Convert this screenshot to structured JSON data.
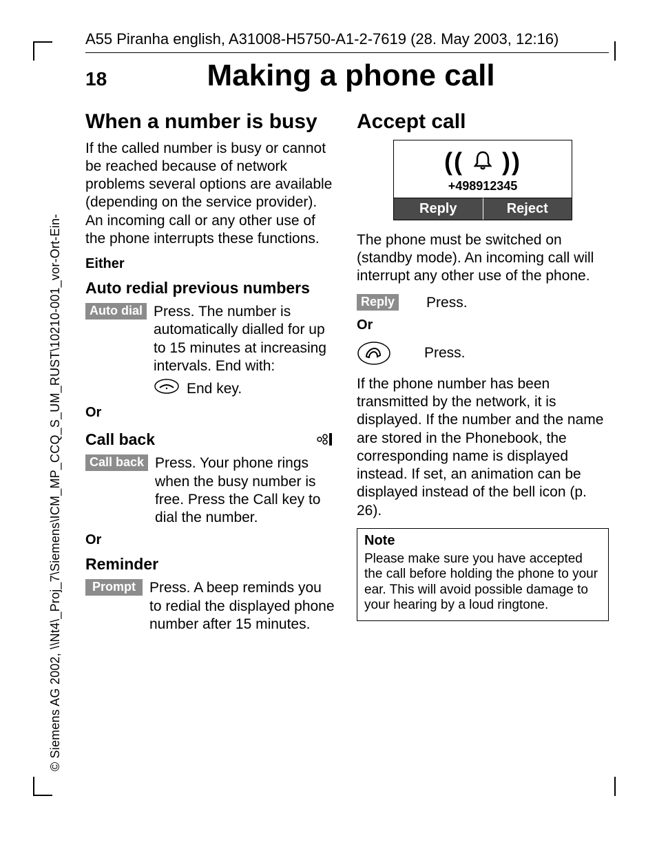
{
  "header": "A55 Piranha english, A31008-H5750-A1-2-7619 (28. May 2003, 12:16)",
  "page_number": "18",
  "page_title": "Making a phone call",
  "side_text": "© Siemens AG 2002, \\\\Nt4\\_Proj_7\\Siemens\\ICM_MP_CCQ_S_UM_RUST\\10210-001_vor-Ort-Ein-",
  "left": {
    "h1": "When a number is busy",
    "intro": "If the called number is busy or cannot be reached because of network problems several options are available (depending on the service provider). An incoming call or any other use of the phone interrupts these functions.",
    "either": "Either",
    "auto_redial_h": "Auto redial previous numbers",
    "auto_dial_key": "Auto dial",
    "auto_dial_text": "Press. The number is automatically dialled for up to 15 minutes at increasing intervals. End with:",
    "end_key_label": "End key.",
    "or1": "Or",
    "callback_h": "Call back",
    "callback_key": "Call back",
    "callback_text": "Press. Your phone rings when the busy number is free. Press the Call key to dial the number.",
    "or2": "Or",
    "reminder_h": "Reminder",
    "prompt_key": "Prompt",
    "prompt_text": "Press. A beep reminds you to redial the displayed phone number after 15 minutes."
  },
  "right": {
    "h1": "Accept call",
    "display_number": "+498912345",
    "btn_reply": "Reply",
    "btn_reject": "Reject",
    "intro": "The phone must be switched on (standby mode). An incoming call will interrupt any other use of the phone.",
    "reply_key": "Reply",
    "reply_text": "Press.",
    "or": "Or",
    "press2": "Press.",
    "para2": "If the phone number has been transmitted by the network, it is displayed. If the number and the name are stored in the Phonebook, the corresponding name is displayed instead. If set, an animation can be displayed instead of the bell icon (p. 26).",
    "note_title": "Note",
    "note_text": "Please make sure you have accepted the call before holding the phone to your ear. This will avoid possible damage to your hearing by a loud ringtone."
  }
}
